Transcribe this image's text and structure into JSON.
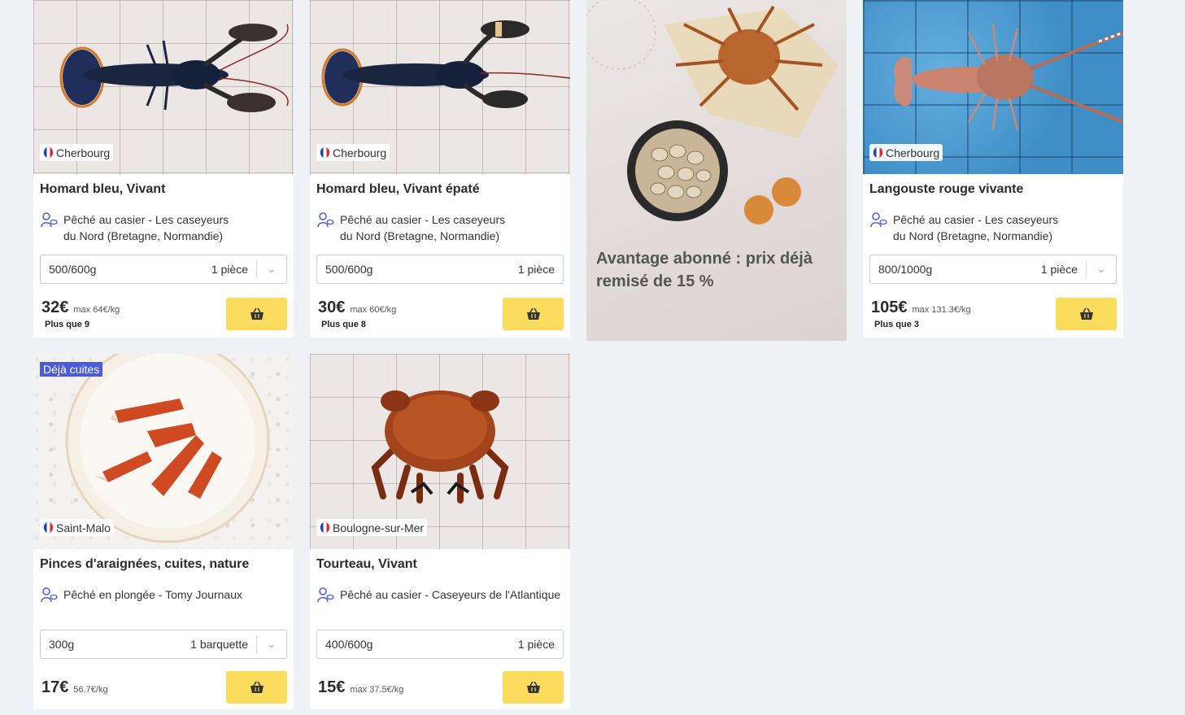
{
  "products": [
    {
      "origin": "Cherbourg",
      "title": "Homard bleu, Vivant",
      "catch_line1": "Pêché au casier - Les caseyeurs",
      "catch_line2": "du Nord (Bretagne, Normandie)",
      "size": "500/600g",
      "quantity": "1 pièce",
      "price": "32€",
      "per_kg": "max 64€/kg",
      "stock": "Plus que 9",
      "icon": "lobster"
    },
    {
      "origin": "Cherbourg",
      "title": "Homard bleu, Vivant épaté",
      "catch_line1": "Pêché au casier - Les caseyeurs",
      "catch_line2": "du Nord (Bretagne, Normandie)",
      "size": "500/600g",
      "quantity": "1 pièce",
      "price": "30€",
      "per_kg": "max 60€/kg",
      "stock": "Plus que 8",
      "icon": "lobster"
    },
    {
      "origin": "Cherbourg",
      "title": "Langouste rouge vivante",
      "catch_line1": "Pêché au casier - Les caseyeurs",
      "catch_line2": "du Nord (Bretagne, Normandie)",
      "size": "800/1000g",
      "quantity": "1 pièce",
      "price": "105€",
      "per_kg": "max 131.3€/kg",
      "stock": "Plus que 3",
      "icon": "spiny-lobster"
    },
    {
      "badge": "Déjà cuites",
      "origin": "Saint-Malo",
      "title": "Pinces d'araignées, cuites, nature",
      "catch_line1": "Pêché en plongée - Tomy Journaux",
      "catch_line2": "",
      "size": "300g",
      "quantity": "1 barquette",
      "price": "17€",
      "per_kg": "56.7€/kg",
      "stock": "",
      "icon": "crab-claws"
    },
    {
      "origin": "Boulogne-sur-Mer",
      "title": "Tourteau, Vivant",
      "catch_line1": "Pêché au casier - Caseyeurs de l'Atlantique",
      "catch_line2": "",
      "size": "400/600g",
      "quantity": "1 pièce",
      "price": "15€",
      "per_kg": "max 37.5€/kg",
      "stock": "",
      "icon": "crab"
    }
  ],
  "promo": {
    "line1": "Avantage abonné : prix déjà",
    "line2": "remisé de 15 %"
  },
  "colors": {
    "page_bg": "#eef2f7",
    "cart_button": "#fcdc5c",
    "badge": "#4a5bdc"
  }
}
